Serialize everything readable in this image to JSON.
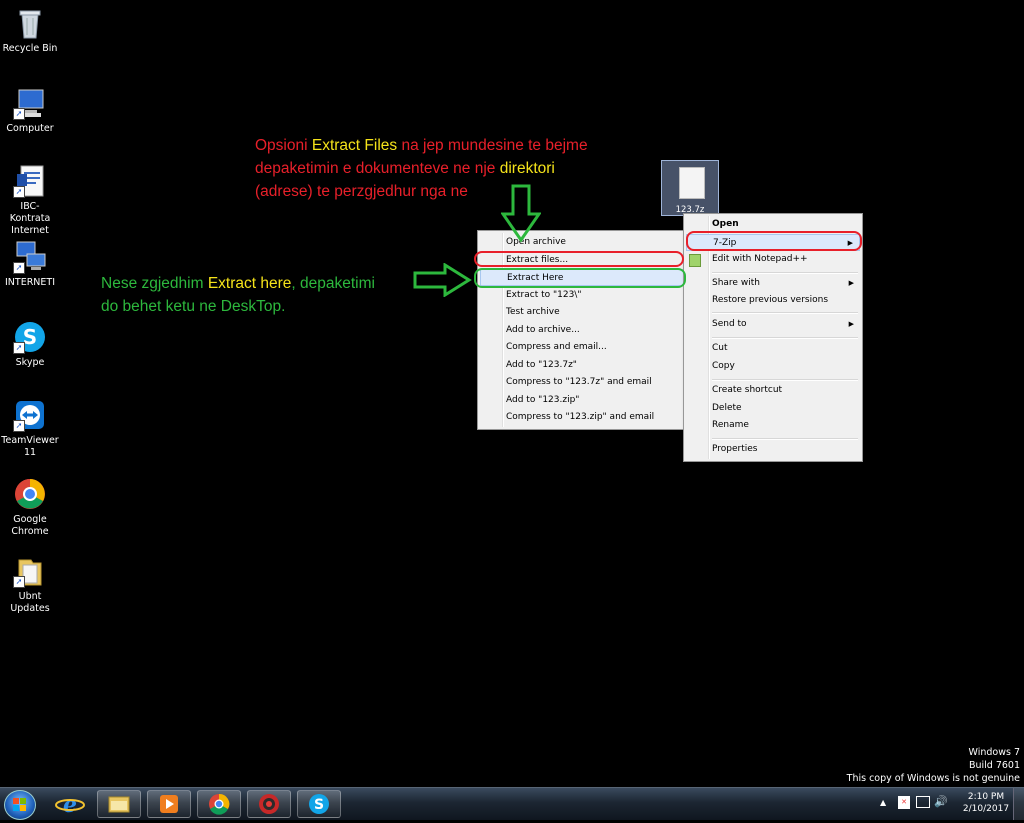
{
  "desktop_icons": [
    {
      "label": "Recycle Bin",
      "icon": "recycle-bin-icon"
    },
    {
      "label": "Computer",
      "icon": "computer-icon"
    },
    {
      "label": "IBC- Kontrata Internet",
      "icon": "word-document-icon"
    },
    {
      "label": "INTERNETI",
      "icon": "network-icon"
    },
    {
      "label": "Skype",
      "icon": "skype-icon"
    },
    {
      "label": "TeamViewer 11",
      "icon": "teamviewer-icon"
    },
    {
      "label": "Google Chrome",
      "icon": "chrome-icon"
    },
    {
      "label": "Ubnt Updates",
      "icon": "folder-icon"
    }
  ],
  "selected_file": {
    "label": "123.7z"
  },
  "context_menu": {
    "items": [
      {
        "label": "Open",
        "bold": true
      },
      {
        "label": "7-Zip",
        "submenu": true
      },
      {
        "label": "Edit with Notepad++"
      },
      {
        "label": "Share with",
        "submenu": true
      },
      {
        "label": "Restore previous versions"
      },
      {
        "label": "Send to",
        "submenu": true
      },
      {
        "label": "Cut"
      },
      {
        "label": "Copy"
      },
      {
        "label": "Create shortcut"
      },
      {
        "label": "Delete"
      },
      {
        "label": "Rename"
      },
      {
        "label": "Properties"
      }
    ]
  },
  "zip_submenu": {
    "items": [
      "Open archive",
      "Extract files...",
      "Extract Here",
      "Extract to \"123\\\"",
      "Test archive",
      "Add to archive...",
      "Compress and email...",
      "Add to \"123.7z\"",
      "Compress to \"123.7z\" and email",
      "Add to \"123.zip\"",
      "Compress to \"123.zip\" and email"
    ]
  },
  "annotations": {
    "top": {
      "line1_a": "Opsioni ",
      "line1_b": "Extract Files",
      "line1_c": " na jep mundesine te bejme",
      "line2_a": "depaketimin e dokumenteve ne nje ",
      "line2_b": "direktori",
      "line3": "(adrese) te perzgjedhur nga ne"
    },
    "left": {
      "line1_a": "Nese zgjedhim ",
      "line1_b": "Extract here",
      "line1_c": ", depaketimi",
      "line2": "do behet ketu ne DeskTop."
    },
    "colors": {
      "red": "#e8202a",
      "yellow": "#f5e31a",
      "green": "#2db83d"
    }
  },
  "watermark": {
    "line1": "Windows 7",
    "line2": "Build 7601",
    "line3": "This copy of Windows is not genuine"
  },
  "taskbar": {
    "pinned": [
      "ie-icon",
      "explorer-icon",
      "media-player-icon",
      "chrome-icon",
      "app-icon",
      "skype-icon"
    ],
    "tray": {
      "time": "2:10 PM",
      "date": "2/10/2017"
    }
  }
}
